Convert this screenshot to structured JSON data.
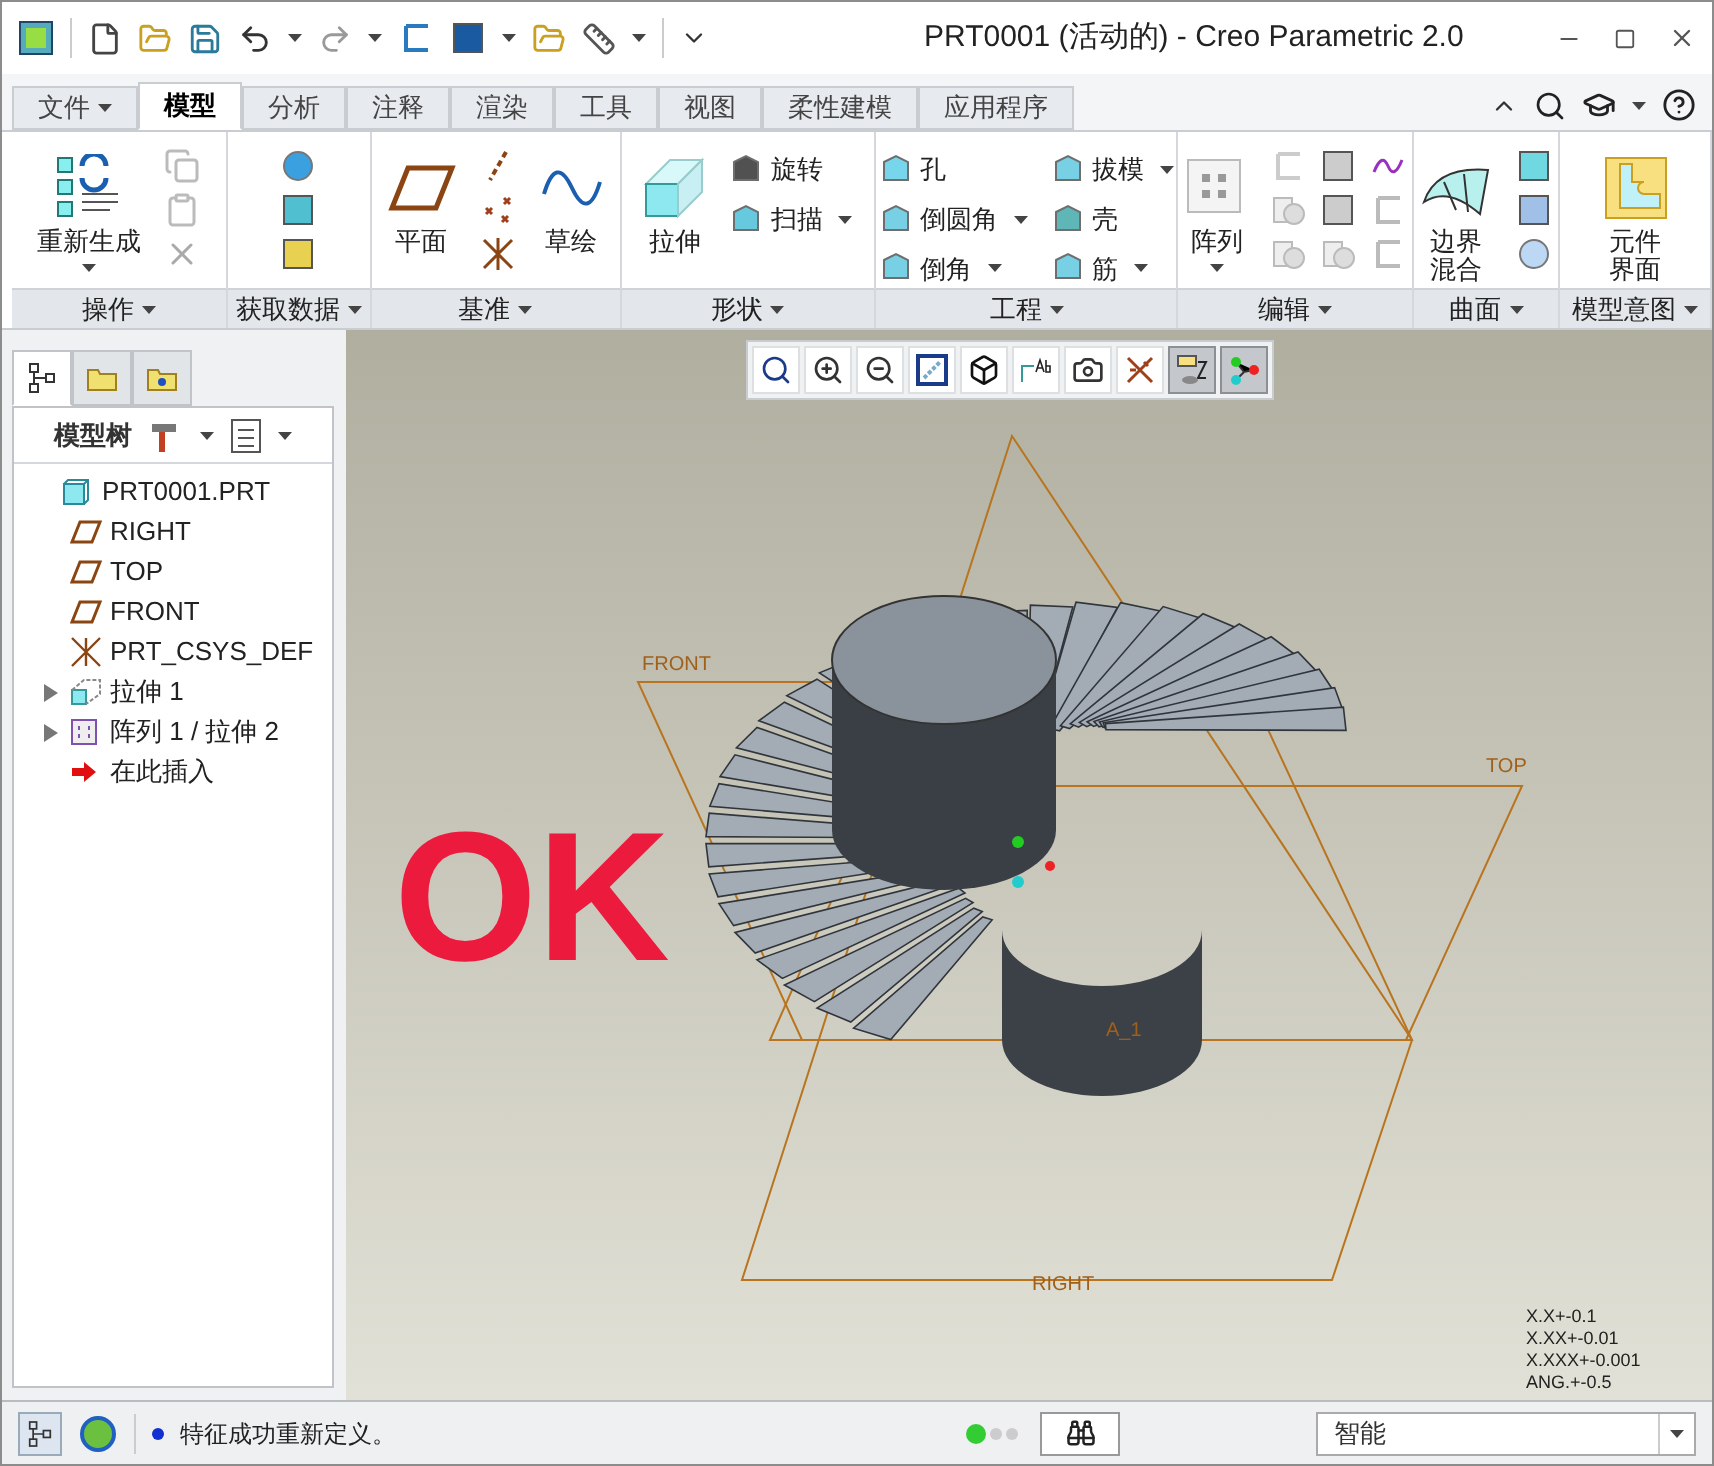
{
  "window": {
    "title": "PRT0001 (活动的) - Creo Parametric 2.0"
  },
  "tabs": [
    {
      "label": "文件",
      "kind": "menu",
      "selected": false
    },
    {
      "label": "模型",
      "kind": "tab",
      "selected": true
    },
    {
      "label": "分析",
      "kind": "tab",
      "selected": false
    },
    {
      "label": "注释",
      "kind": "tab",
      "selected": false
    },
    {
      "label": "渲染",
      "kind": "tab",
      "selected": false
    },
    {
      "label": "工具",
      "kind": "tab",
      "selected": false
    },
    {
      "label": "视图",
      "kind": "tab",
      "selected": false
    },
    {
      "label": "柔性建模",
      "kind": "tab",
      "selected": false
    },
    {
      "label": "应用程序",
      "kind": "tab",
      "selected": false
    }
  ],
  "ribbon_groups": [
    {
      "label": "操作",
      "items": [
        {
          "kind": "large",
          "label": "重新生成",
          "dropdown": true
        },
        {
          "kind": "icons"
        }
      ]
    },
    {
      "label": "获取数据",
      "items": [
        {
          "kind": "icons"
        }
      ]
    },
    {
      "label": "基准",
      "items": [
        {
          "kind": "large",
          "label": "平面",
          "dropdown": false
        },
        {
          "kind": "icons"
        },
        {
          "kind": "large",
          "label": "草绘",
          "dropdown": false
        }
      ]
    },
    {
      "label": "形状",
      "items": [
        {
          "kind": "large",
          "label": "拉伸",
          "dropdown": false
        },
        {
          "kind": "small",
          "label": "旋转",
          "dropdown": false
        },
        {
          "kind": "small",
          "label": "扫描",
          "dropdown": true
        }
      ]
    },
    {
      "label": "工程",
      "items": [
        {
          "kind": "small",
          "label": "孔",
          "dropdown": false
        },
        {
          "kind": "small",
          "label": "倒圆角",
          "dropdown": true
        },
        {
          "kind": "small",
          "label": "倒角",
          "dropdown": true
        },
        {
          "kind": "small",
          "label": "拔模",
          "dropdown": true
        },
        {
          "kind": "small",
          "label": "壳",
          "dropdown": false
        },
        {
          "kind": "small",
          "label": "筋",
          "dropdown": true
        }
      ]
    },
    {
      "label": "编辑",
      "items": [
        {
          "kind": "large",
          "label": "阵列",
          "dropdown": true
        },
        {
          "kind": "icons"
        }
      ]
    },
    {
      "label": "曲面",
      "items": [
        {
          "kind": "stacked",
          "label": "边界混合",
          "dropdown": false
        },
        {
          "kind": "icons"
        }
      ]
    },
    {
      "label": "模型意图",
      "items": [
        {
          "kind": "stacked",
          "label": "元件界面",
          "dropdown": false
        }
      ]
    }
  ],
  "panel_tabs": [
    {
      "selected": true
    },
    {
      "selected": false
    },
    {
      "selected": false
    }
  ],
  "model_tree": {
    "title": "模型树",
    "root": {
      "label": "PRT0001.PRT",
      "kind": "part",
      "children": [
        {
          "label": "RIGHT",
          "kind": "plane"
        },
        {
          "label": "TOP",
          "kind": "plane"
        },
        {
          "label": "FRONT",
          "kind": "plane"
        },
        {
          "label": "PRT_CSYS_DEF",
          "kind": "csys"
        },
        {
          "label": "拉伸 1",
          "kind": "extrude",
          "expanded": false
        },
        {
          "label": "阵列 1 / 拉伸 2",
          "kind": "pattern",
          "expanded": false
        },
        {
          "label": "在此插入",
          "kind": "insert"
        }
      ]
    }
  },
  "view_toolbar": [
    {
      "selected": false
    },
    {
      "selected": false
    },
    {
      "selected": false
    },
    {
      "selected": false
    },
    {
      "selected": false
    },
    {
      "selected": false
    },
    {
      "selected": false
    },
    {
      "selected": false
    },
    {
      "selected": true
    },
    {
      "selected": true
    }
  ],
  "viewport": {
    "datum_labels": {
      "front": "FRONT",
      "top": "TOP",
      "right": "RIGHT",
      "axis": "A_1"
    },
    "tolerances": [
      "X.X+-0.1",
      "X.XX+-0.01",
      "X.XXX+-0.001",
      "ANG.+-0.5"
    ],
    "overlay_text": "OK"
  },
  "status_bar": {
    "message": "特征成功重新定义。",
    "filter": "智能"
  }
}
